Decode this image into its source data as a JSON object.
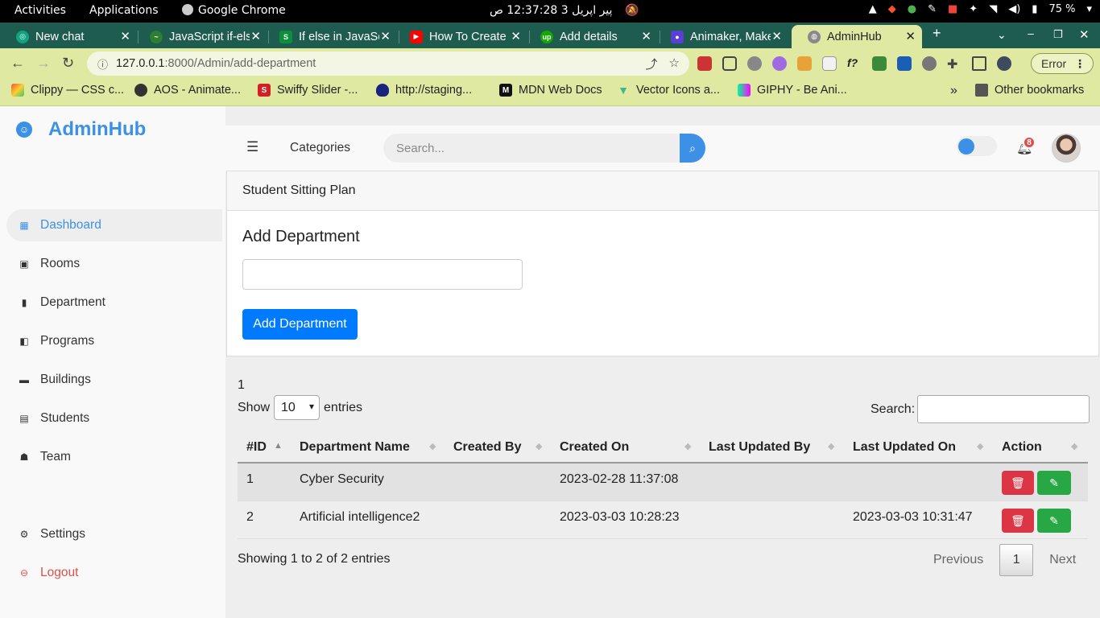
{
  "system_bar": {
    "activities": "Activities",
    "applications": "Applications",
    "active_app": "Google Chrome",
    "clock": "پیر اپریل 3  12:37:28 ص",
    "battery": "75 %"
  },
  "browser": {
    "tabs": [
      {
        "label": "New chat",
        "favicon_color": "#10a37f"
      },
      {
        "label": "JavaScript if-else",
        "favicon_color": "#2e7d32"
      },
      {
        "label": "If else in JavaScript",
        "favicon_color": "#0b8f3c"
      },
      {
        "label": "How To Create",
        "favicon_color": "#ff0000"
      },
      {
        "label": "Add details",
        "favicon_color": "#14a800"
      },
      {
        "label": "Animaker, Make",
        "favicon_color": "#5b3fd1"
      },
      {
        "label": "AdminHub",
        "favicon_color": "#777777"
      }
    ],
    "url_host": "127.0.0.1",
    "url_path": ":8000/Admin/add-department",
    "error_label": "Error",
    "bookmarks": [
      {
        "label": "Clippy — CSS c...",
        "icon": "clippy-icon"
      },
      {
        "label": "AOS - Animate...",
        "icon": "aos-icon"
      },
      {
        "label": "Swiffy Slider -...",
        "icon": "swiffy-icon"
      },
      {
        "label": "http://staging...",
        "icon": "shield-icon"
      },
      {
        "label": "MDN Web Docs",
        "icon": "mdn-icon"
      },
      {
        "label": "Vector Icons a...",
        "icon": "vue-icon"
      },
      {
        "label": "GIPHY - Be Ani...",
        "icon": "giphy-icon"
      }
    ],
    "other_bookmarks": "Other bookmarks"
  },
  "sidebar": {
    "brand": "AdminHub",
    "items": [
      {
        "label": "Dashboard",
        "icon": "dashboard-icon"
      },
      {
        "label": "Rooms",
        "icon": "rooms-icon"
      },
      {
        "label": "Department",
        "icon": "department-icon"
      },
      {
        "label": "Programs",
        "icon": "programs-icon"
      },
      {
        "label": "Buildings",
        "icon": "buildings-icon"
      },
      {
        "label": "Students",
        "icon": "students-icon"
      },
      {
        "label": "Team",
        "icon": "team-icon"
      }
    ],
    "settings": "Settings",
    "logout": "Logout"
  },
  "topnav": {
    "categories": "Categories",
    "search_placeholder": "Search...",
    "notification_count": "8"
  },
  "card": {
    "header": "Student Sitting Plan",
    "title": "Add Department",
    "input_value": "",
    "button": "Add Department"
  },
  "datatable": {
    "count_line": "1",
    "show_label": "Show",
    "entries_label": "entries",
    "page_size": "10",
    "search_label": "Search:",
    "columns": [
      "#ID",
      "Department Name",
      "Created By",
      "Created On",
      "Last Updated By",
      "Last Updated On",
      "Action"
    ],
    "rows": [
      {
        "id": "1",
        "name": "Cyber Security",
        "created_by": "",
        "created_on": "2023-02-28 11:37:08",
        "updated_by": "",
        "updated_on": ""
      },
      {
        "id": "2",
        "name": "Artificial intelligence2",
        "created_by": "",
        "created_on": "2023-03-03 10:28:23",
        "updated_by": "",
        "updated_on": "2023-03-03 10:31:47"
      }
    ],
    "info": "Showing 1 to 2 of 2 entries",
    "previous": "Previous",
    "current_page": "1",
    "next": "Next"
  },
  "colors": {
    "accent": "#3c91e6",
    "primary_button": "#007bff",
    "danger": "#dc3545",
    "success": "#28a745",
    "logout": "#db504a"
  }
}
